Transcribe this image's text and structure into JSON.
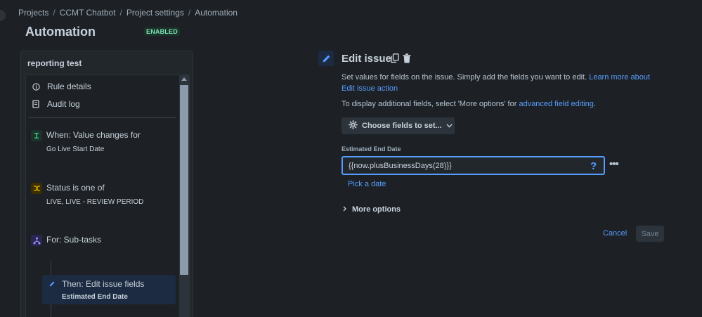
{
  "breadcrumb": [
    "Projects",
    "CCMT Chatbot",
    "Project settings",
    "Automation"
  ],
  "page": {
    "title": "Automation",
    "status": "ENABLED"
  },
  "rule": {
    "name": "reporting test",
    "menu": [
      {
        "label": "Rule details",
        "icon": "info-icon"
      },
      {
        "label": "Audit log",
        "icon": "document-icon"
      }
    ],
    "steps": [
      {
        "title": "When: Value changes for",
        "sub": "Go Live Start Date",
        "icon": "trigger-icon",
        "color": "#1f845a"
      },
      {
        "title": "Status is one of",
        "sub": "LIVE, LIVE - REVIEW PERIOD",
        "icon": "shuffle-icon",
        "color": "#946f00"
      },
      {
        "title": "For: Sub-tasks",
        "sub": "",
        "icon": "branch-icon",
        "color": "#5e4db2"
      }
    ],
    "then": {
      "title": "Then: Edit issue fields",
      "sub": "Estimated End Date"
    }
  },
  "editor": {
    "title": "Edit issue",
    "desc_text": "Set values for fields on the issue. Simply add the fields you want to edit. ",
    "desc_link": "Learn more about Edit issue action",
    "desc2_text": "To display additional fields, select 'More options' for ",
    "desc2_link": "advanced field editing",
    "desc2_end": ".",
    "choose_label": "Choose fields to set...",
    "field_label": "Estimated End Date",
    "field_value": "{{now.plusBusinessDays(28)}}",
    "help": "?",
    "more": "•••",
    "pick_date": "Pick a date",
    "more_options": "More options",
    "cancel": "Cancel",
    "save": "Save"
  },
  "colors": {
    "accent": "#579dff",
    "badge_bg": "#1c3329",
    "badge_text": "#7ee2b8"
  }
}
